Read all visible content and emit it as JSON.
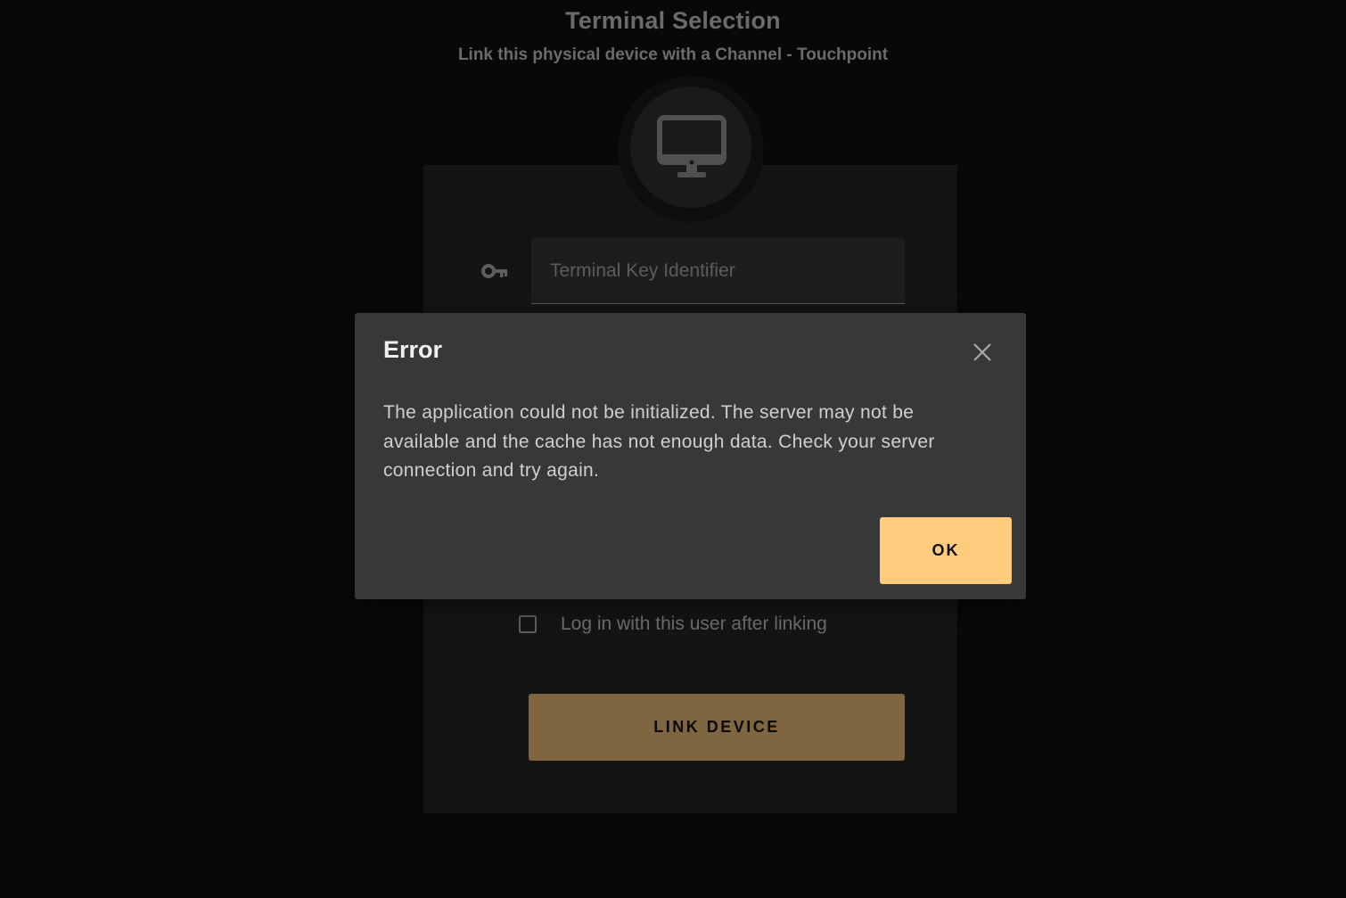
{
  "header": {
    "title": "Terminal Selection",
    "subtitle": "Link this physical device with a Channel - Touchpoint"
  },
  "form": {
    "device_icon": "monitor-icon",
    "key_icon": "key-icon",
    "terminal_key": {
      "placeholder": "Terminal Key Identifier",
      "value": ""
    },
    "login_after_linking": {
      "label": "Log in with this user after linking",
      "checked": false
    },
    "link_button_label": "LINK DEVICE"
  },
  "dialog": {
    "title": "Error",
    "message": "The application could not be initialized. The server may not be available and the cache has not enough data. Check your server connection and try again.",
    "ok_label": "OK",
    "close_icon": "close-icon"
  },
  "colors": {
    "accent": "#ffcb7d",
    "accent_dimmed": "#7f6540",
    "dialog_bg": "#383838",
    "page_bg": "#080808"
  }
}
